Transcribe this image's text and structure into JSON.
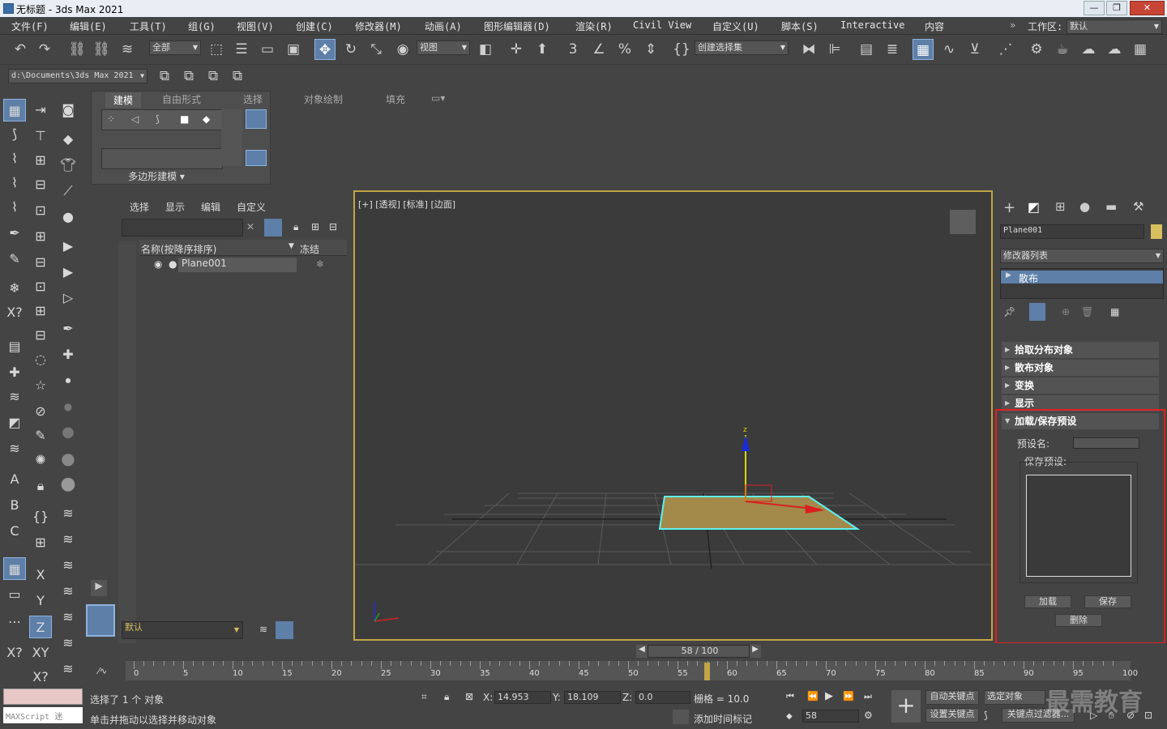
{
  "window": {
    "title": "无标题 - 3ds Max 2021"
  },
  "menu": [
    "文件(F)",
    "编辑(E)",
    "工具(T)",
    "组(G)",
    "视图(V)",
    "创建(C)",
    "修改器(M)",
    "动画(A)",
    "图形编辑器(D)",
    "渲染(R)",
    "Civil View",
    "自定义(U)",
    "脚本(S)",
    "Interactive",
    "内容"
  ],
  "workspace": {
    "label": "工作区:",
    "value": "默认"
  },
  "toolbar": {
    "filter": "全部",
    "refcoord": "视图",
    "selset": "创建选择集",
    "path": "d:\\Documents\\3ds Max 2021"
  },
  "ribbon": {
    "tabs": [
      "建模",
      "自由形式",
      "选择",
      "对象绘制",
      "填充"
    ],
    "panel_label": "多边形建模"
  },
  "scene": {
    "tabs": [
      "选择",
      "显示",
      "编辑",
      "自定义"
    ],
    "col_name": "名称(按降序排序)",
    "col_freeze": "冻结",
    "items": [
      "Plane001"
    ],
    "layer": "默认"
  },
  "viewport": {
    "label": "[+] [透视] [标准] [边面]",
    "axis_z": "z"
  },
  "cmd": {
    "object_name": "Plane001",
    "modlist": "修改器列表",
    "stack_item": "散布",
    "rollouts": [
      "拾取分布对象",
      "散布对象",
      "变换",
      "显示"
    ],
    "open_rollout": "加载/保存预设",
    "preset_name_label": "预设名:",
    "save_presets_label": "保存预设:",
    "load": "加载",
    "save": "保存",
    "delete": "删除"
  },
  "timeline": {
    "frame": "58 / 100",
    "ticks": [
      "0",
      "5",
      "10",
      "15",
      "20",
      "25",
      "30",
      "35",
      "40",
      "45",
      "50",
      "55",
      "60",
      "65",
      "70",
      "75",
      "80",
      "85",
      "90",
      "95",
      "100"
    ]
  },
  "status": {
    "selected": "选择了 1 个 对象",
    "hint": "单击并拖动以选择并移动对象",
    "maxscript": "MAXScript 迷",
    "x_label": "X:",
    "x": "14.953",
    "y_label": "Y:",
    "y": "18.109",
    "z_label": "Z:",
    "z": "0.0",
    "grid": "栅格 = 10.0",
    "add_tag": "添加时间标记",
    "frame_field": "58",
    "autokey": "自动关键点",
    "selobj": "选定对象",
    "setkey": "设置关键点",
    "keyfilter": "关键点过滤器...",
    "watermark": "最需教育"
  },
  "colors": {
    "accent": "#5d7fa8",
    "viewport_border": "#c1a548",
    "highlight": "#e02020"
  }
}
